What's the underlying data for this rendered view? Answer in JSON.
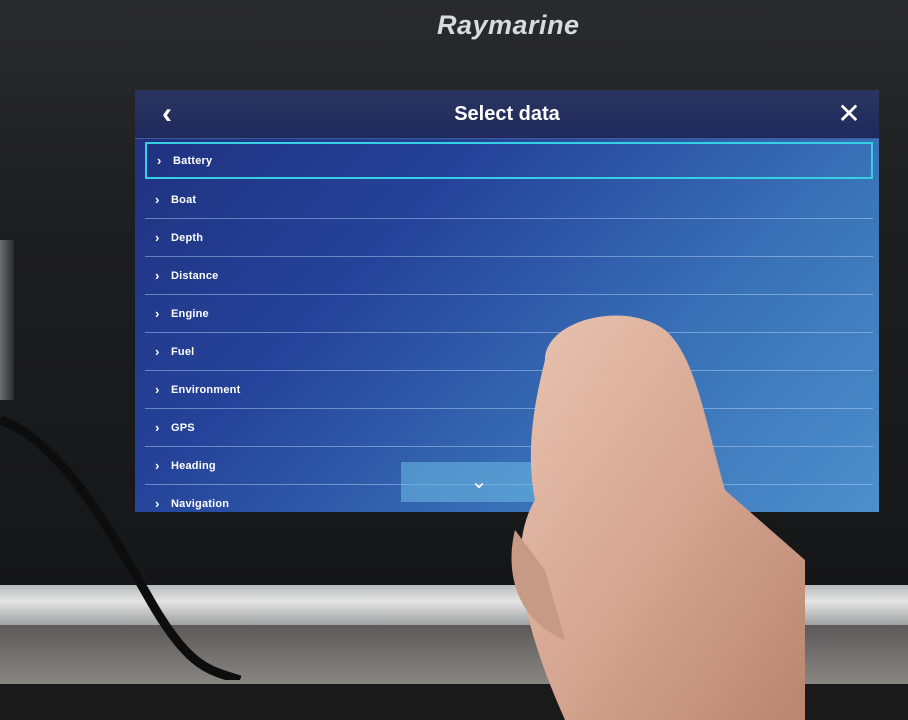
{
  "device": {
    "brand": "Raymarine"
  },
  "dialog": {
    "title": "Select data",
    "back_icon": "chevron-left-icon",
    "close_icon": "close-icon",
    "items": [
      {
        "label": "Battery",
        "selected": true
      },
      {
        "label": "Boat"
      },
      {
        "label": "Depth"
      },
      {
        "label": "Distance"
      },
      {
        "label": "Engine"
      },
      {
        "label": "Fuel"
      },
      {
        "label": "Environment"
      },
      {
        "label": "GPS"
      },
      {
        "label": "Heading"
      },
      {
        "label": "Navigation"
      }
    ],
    "scroll_icon": "chevron-down-icon"
  },
  "colors": {
    "accent_select": "#35d0e6",
    "screen_bg": "#25439a"
  }
}
